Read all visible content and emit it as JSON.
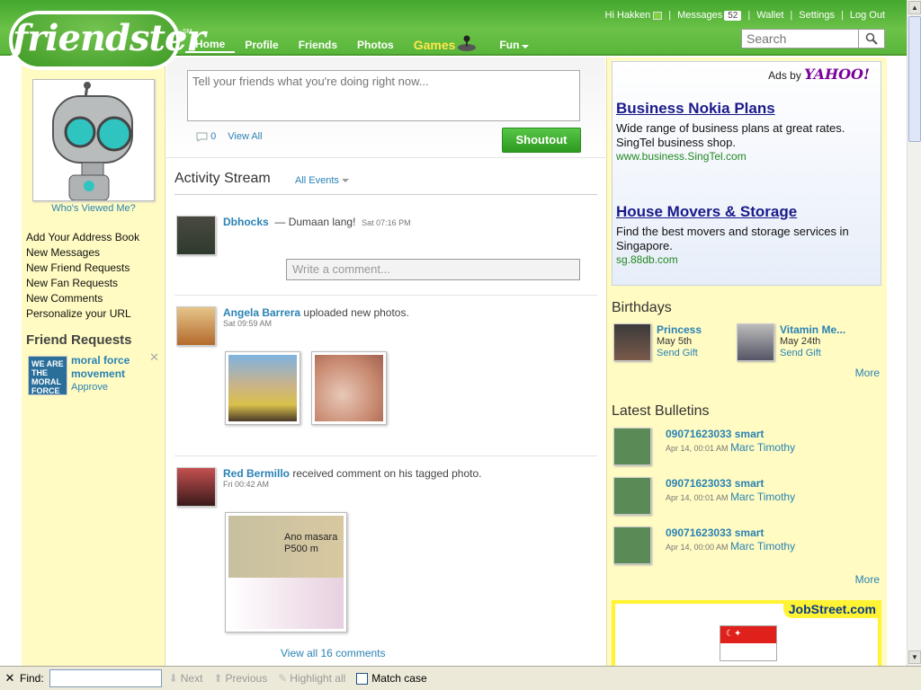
{
  "header": {
    "logo_text": "friendster",
    "trademark": "SM",
    "greeting": "Hi Hakken",
    "messages_label": "Messages",
    "messages_count": "52",
    "wallet": "Wallet",
    "settings": "Settings",
    "logout": "Log Out",
    "nav": {
      "home": "Home",
      "profile": "Profile",
      "friends": "Friends",
      "photos": "Photos",
      "games": "Games",
      "fun": "Fun"
    },
    "search_placeholder": "Search"
  },
  "left": {
    "who_viewed": "Who's Viewed Me?",
    "links": [
      "Add Your Address Book",
      "New Messages",
      "New Friend Requests",
      "New Fan Requests",
      "New Comments",
      "Personalize your URL"
    ],
    "friend_requests_title": "Friend Requests",
    "request": {
      "name": "moral force movement",
      "img_text": "WE ARE THE MORAL FORCE",
      "approve": "Approve"
    }
  },
  "status": {
    "placeholder": "Tell your friends what you're doing right now...",
    "comment_count": "0",
    "view_all": "View All",
    "shoutout": "Shoutout"
  },
  "stream": {
    "title": "Activity Stream",
    "filter": "All Events",
    "events": [
      {
        "name": "Dbhocks",
        "text": "— Dumaan lang!",
        "time": "Sat 07:16 PM",
        "comment_placeholder": "Write a comment..."
      },
      {
        "name": "Angela Barrera",
        "text": "uploaded new photos.",
        "time": "Sat 09:59 AM"
      },
      {
        "name": "Red Bermillo",
        "text": "received comment on his tagged photo.",
        "time": "Fri 00:42 AM"
      }
    ],
    "photo3_text": "Ano masara P500 m",
    "view_all_comments": "View all 16 comments"
  },
  "ads": {
    "ads_by": "Ads by",
    "yahoo": "YAHOO!",
    "items": [
      {
        "title": "Business Nokia Plans",
        "desc": "Wide range of business plans at great rates. SingTel business shop.",
        "url": "www.business.SingTel.com"
      },
      {
        "title": "House Movers & Storage",
        "desc": "Find the best movers and storage services in Singapore.",
        "url": "sg.88db.com"
      }
    ]
  },
  "birthdays": {
    "title": "Birthdays",
    "items": [
      {
        "name": "Princess",
        "date": "May 5th",
        "gift": "Send Gift"
      },
      {
        "name": "Vitamin Me...",
        "date": "May 24th",
        "gift": "Send Gift"
      }
    ],
    "more": "More"
  },
  "bulletins": {
    "title": "Latest Bulletins",
    "items": [
      {
        "subject": "09071623033 smart",
        "time": "Apr 14, 00:01 AM",
        "author": "Marc Timothy"
      },
      {
        "subject": "09071623033 smart",
        "time": "Apr 14, 00:01 AM",
        "author": "Marc Timothy"
      },
      {
        "subject": "09071623033 smart",
        "time": "Apr 14, 00:00 AM",
        "author": "Marc Timothy"
      }
    ],
    "more": "More"
  },
  "jobstreet": {
    "logo": "JobStreet.com"
  },
  "findbar": {
    "label": "Find:",
    "next": "Next",
    "previous": "Previous",
    "highlight": "Highlight all",
    "match_case": "Match case"
  }
}
